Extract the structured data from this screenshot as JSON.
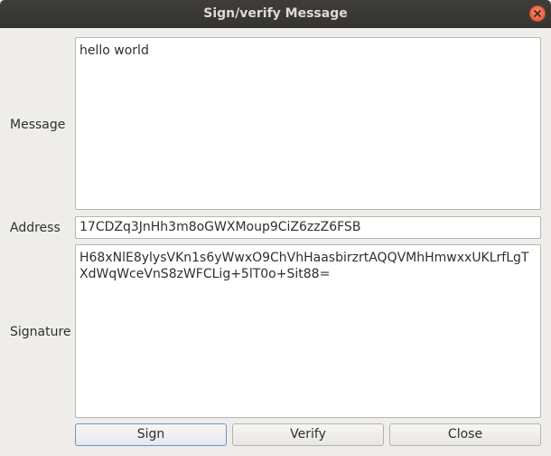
{
  "window": {
    "title": "Sign/verify Message"
  },
  "labels": {
    "message": "Message",
    "address": "Address",
    "signature": "Signature"
  },
  "fields": {
    "message": "hello world",
    "address": "17CDZq3JnHh3m8oGWXMoup9CiZ6zzZ6FSB",
    "signature": "H68xNlE8ylysVKn1s6yWwxO9ChVhHaasbirzrtAQQVMhHmwxxUKLrfLgTXdWqWceVnS8zWFCLig+5lT0o+Sit88="
  },
  "buttons": {
    "sign": "Sign",
    "verify": "Verify",
    "close": "Close"
  },
  "icons": {
    "close": "close-icon"
  }
}
